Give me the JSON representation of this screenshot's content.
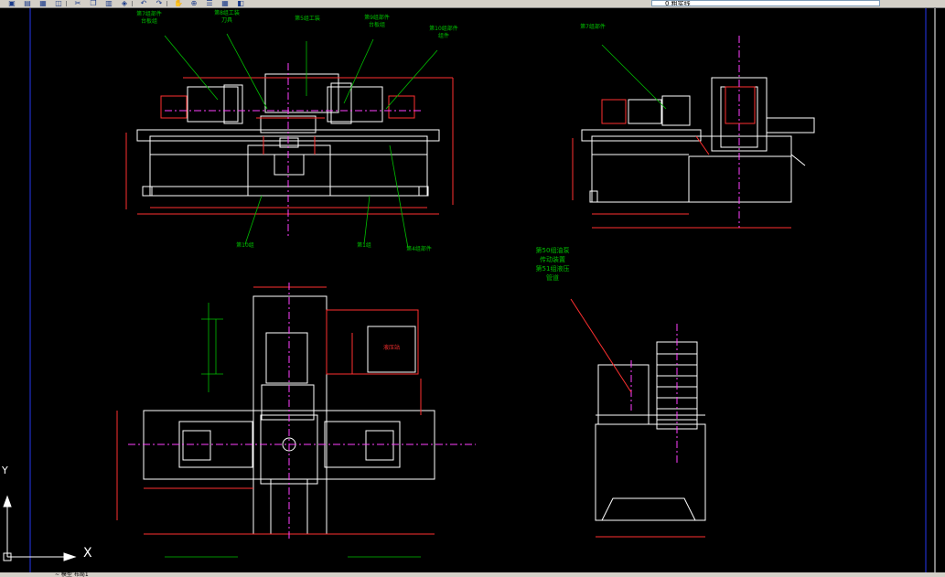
{
  "toolbar": {
    "icons": [
      "open-icon",
      "save-icon",
      "print-icon",
      "preview-icon",
      "cut-icon",
      "copy-icon",
      "paste-icon",
      "match-icon",
      "undo-icon",
      "redo-icon",
      "pan-icon",
      "zoom-icon",
      "properties-icon",
      "designcenter-icon",
      "layer-icon"
    ],
    "layer_name": "0 粗实线"
  },
  "drawing": {
    "front_view": {
      "callouts": [
        "第7组部件",
        "第8组工装",
        "第5组工装",
        "第9组部件",
        "第10组部件",
        "第10组",
        "第1组",
        "第4组部件"
      ],
      "sub_labels": [
        "台板组",
        "刀具",
        "台板组",
        "组件"
      ]
    },
    "side_view": {
      "callouts": [
        "第7组部件"
      ]
    },
    "hydraulic_station": {
      "callout_lines": [
        "第50组油泵",
        "传动装置",
        "第51组液压",
        "管道"
      ]
    },
    "plan_view": {
      "box_label": "液压站"
    }
  },
  "status": {
    "coords": "~ 模型 布局1"
  },
  "ucs": {
    "x_label": "X",
    "y_label": "Y"
  }
}
